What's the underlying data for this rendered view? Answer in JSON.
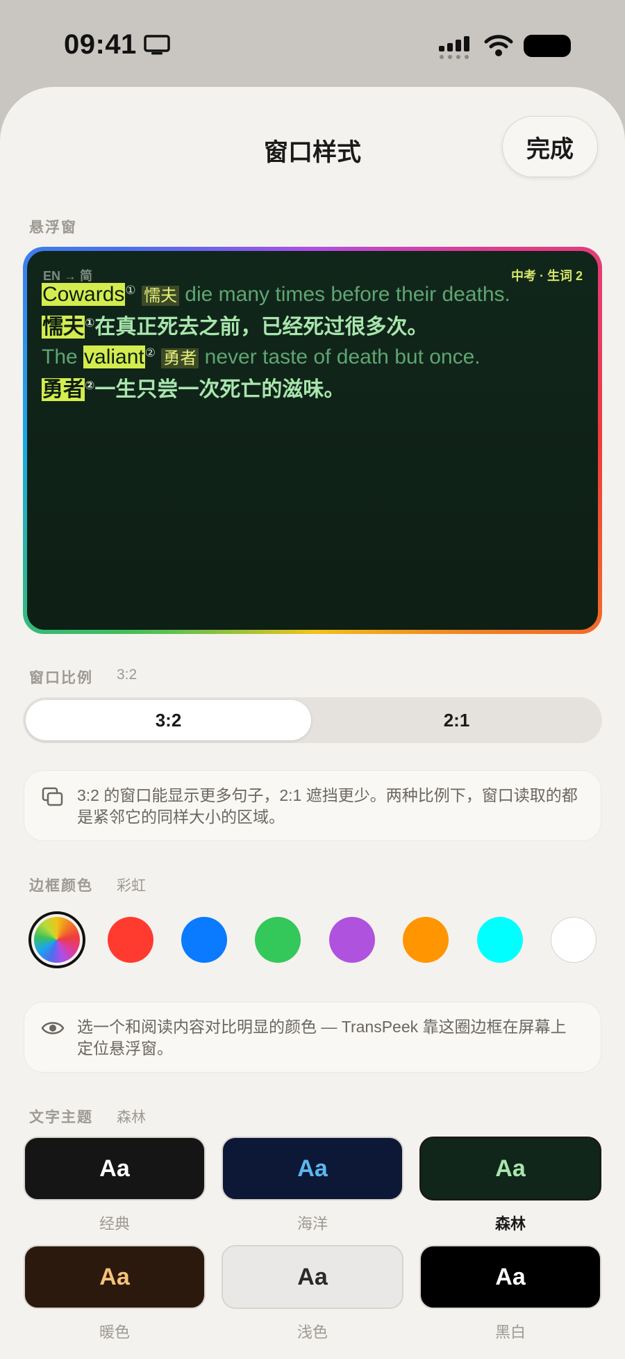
{
  "status_bar": {
    "time": "09:41"
  },
  "header": {
    "title": "窗口样式",
    "done_label": "完成"
  },
  "floating_window": {
    "section_label": "悬浮窗",
    "lang_pair": "EN → 简",
    "stats": "中考 · 生词 2",
    "sentence1": {
      "word": "Cowards",
      "marker": "①",
      "gloss": "懦夫",
      "rest": " die many times before their deaths.",
      "zh_word": "懦夫",
      "zh_marker": "①",
      "zh_rest": "在真正死去之前，已经死过很多次。"
    },
    "sentence2": {
      "prefix": "The ",
      "word": "valiant",
      "marker": "②",
      "gloss": "勇者",
      "rest": " never taste of death but once.",
      "zh_word": "勇者",
      "zh_marker": "②",
      "zh_rest": "一生只尝一次死亡的滋味。"
    }
  },
  "ratio": {
    "label": "窗口比例",
    "value": "3:2",
    "options": [
      "3:2",
      "2:1"
    ],
    "selected": "3:2",
    "info": "3:2 的窗口能显示更多句子，2:1 遮挡更少。两种比例下，窗口读取的都是紧邻它的同样大小的区域。"
  },
  "border_color": {
    "label": "边框颜色",
    "value": "彩虹",
    "swatches": [
      {
        "name": "rainbow",
        "color": "rainbow",
        "selected": true
      },
      {
        "name": "red",
        "color": "#ff3b30"
      },
      {
        "name": "blue",
        "color": "#0a7aff"
      },
      {
        "name": "green",
        "color": "#34c759"
      },
      {
        "name": "purple",
        "color": "#af52de"
      },
      {
        "name": "orange",
        "color": "#ff9500"
      },
      {
        "name": "cyan",
        "color": "#00ffff"
      },
      {
        "name": "white",
        "color": "#ffffff"
      }
    ],
    "info": "选一个和阅读内容对比明显的颜色 — TransPeek 靠这圈边框在屏幕上定位悬浮窗。"
  },
  "text_theme": {
    "label": "文字主题",
    "value": "森林",
    "sample": "Aa",
    "themes": [
      {
        "name": "经典",
        "bg": "#151515",
        "fg": "#ffffff"
      },
      {
        "name": "海洋",
        "bg": "#0d1836",
        "fg": "#5ab8f0"
      },
      {
        "name": "森林",
        "bg": "#11261b",
        "fg": "#a8e6ad",
        "selected": true
      },
      {
        "name": "暖色",
        "bg": "#2c190d",
        "fg": "#f5c27a"
      },
      {
        "name": "浅色",
        "bg": "#e9e8e6",
        "fg": "#2a2a2a"
      },
      {
        "name": "黑白",
        "bg": "#000000",
        "fg": "#ffffff"
      }
    ]
  }
}
